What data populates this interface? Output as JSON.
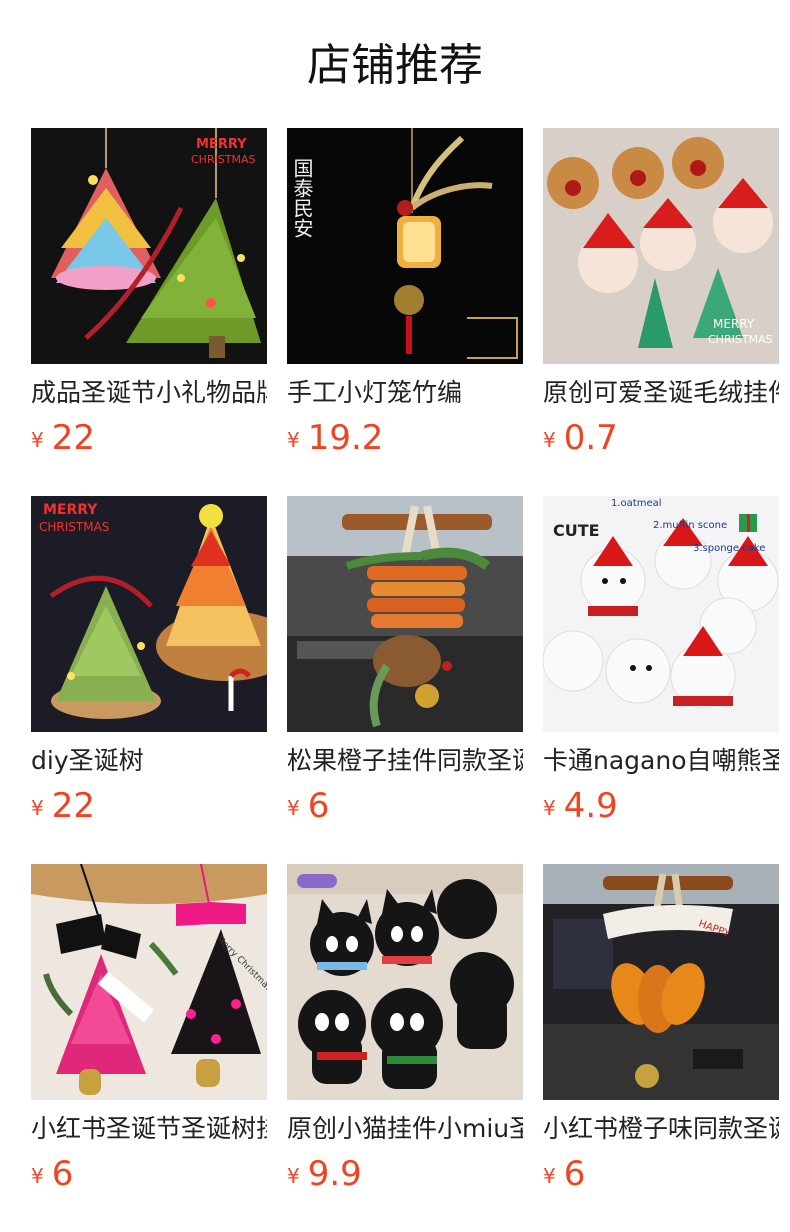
{
  "header": {
    "title": "店铺推荐"
  },
  "products": [
    {
      "name": "成品圣诞节小礼物品牌",
      "currency": "¥",
      "price": "22",
      "image_text": [
        "MERRY",
        "CHRISTMAS"
      ]
    },
    {
      "name": "手工小灯笼竹编",
      "currency": "¥",
      "price": "19.2",
      "image_text": [
        "国泰民安"
      ]
    },
    {
      "name": "原创可爱圣诞毛绒挂件",
      "currency": "¥",
      "price": "0.7",
      "image_text": [
        "MERRY",
        "CHRISTMAS"
      ]
    },
    {
      "name": "diy圣诞树",
      "currency": "¥",
      "price": "22",
      "image_text": [
        "MERRY",
        "CHRISTMAS"
      ]
    },
    {
      "name": "松果橙子挂件同款圣诞",
      "currency": "¥",
      "price": "6",
      "image_text": []
    },
    {
      "name": "卡通nagano自嘲熊圣诞",
      "currency": "¥",
      "price": "4.9",
      "image_text": [
        "CUTE",
        "1.oatmeal",
        "2.muffin scone",
        "3.sponge cake"
      ]
    },
    {
      "name": "小红书圣诞节圣诞树挂件",
      "currency": "¥",
      "price": "6",
      "image_text": [
        "Merry Christmas"
      ]
    },
    {
      "name": "原创小猫挂件小miu圣诞",
      "currency": "¥",
      "price": "9.9",
      "image_text": []
    },
    {
      "name": "小红书橙子味同款圣诞",
      "currency": "¥",
      "price": "6",
      "image_text": [
        "HAPPY"
      ]
    }
  ],
  "colors": {
    "price": "#ee4422",
    "title": "#111111",
    "text": "#222222"
  }
}
